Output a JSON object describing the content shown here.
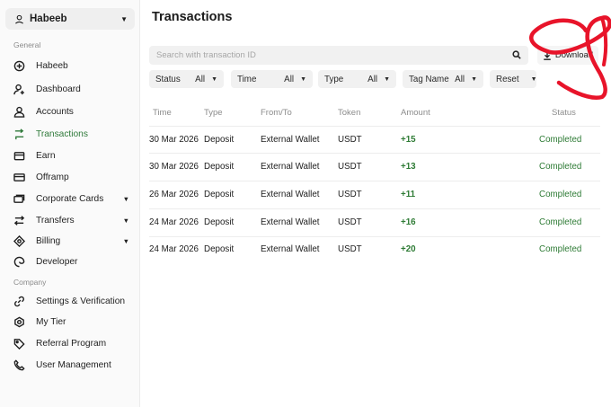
{
  "account": {
    "name": "Habeeb",
    "icon": "user-icon"
  },
  "sidebar": {
    "general_label": "General",
    "company_label": "Company",
    "items": [
      {
        "label": "Habeeb",
        "icon": "plus-circle-icon",
        "active": false
      },
      {
        "label": "Dashboard",
        "icon": "user-plus-icon",
        "active": false
      },
      {
        "label": "Accounts",
        "icon": "user-icon",
        "active": false
      },
      {
        "label": "Transactions",
        "icon": "transfer-arrows-icon",
        "active": true
      },
      {
        "label": "Earn",
        "icon": "wallet-icon",
        "active": false
      },
      {
        "label": "Offramp",
        "icon": "card-icon",
        "active": false
      },
      {
        "label": "Corporate Cards",
        "icon": "card-stack-icon",
        "active": false,
        "expandable": true
      },
      {
        "label": "Transfers",
        "icon": "transfer-icon",
        "active": false,
        "expandable": true
      },
      {
        "label": "Billing",
        "icon": "diamond-icon",
        "active": false,
        "expandable": true
      },
      {
        "label": "Developer",
        "icon": "swirl-icon",
        "active": false
      }
    ],
    "company_items": [
      {
        "label": "Settings & Verification",
        "icon": "link-icon"
      },
      {
        "label": "My Tier",
        "icon": "tier-icon"
      },
      {
        "label": "Referral Program",
        "icon": "tag-icon"
      },
      {
        "label": "User Management",
        "icon": "phone-icon"
      }
    ]
  },
  "main": {
    "title": "Transactions",
    "search_placeholder": "Search with transaction ID",
    "download_label": "Download",
    "filters": [
      {
        "label": "Status",
        "value": "All"
      },
      {
        "label": "Time",
        "value": "All"
      },
      {
        "label": "Type",
        "value": "All"
      },
      {
        "label": "Tag Name",
        "value": "All"
      },
      {
        "label": "Reset",
        "value": ""
      }
    ],
    "columns": [
      "Time",
      "Type",
      "From/To",
      "Token",
      "Amount",
      "Status"
    ],
    "rows": [
      {
        "time": "30 Mar 2026",
        "type": "Deposit",
        "from_to": "External Wallet",
        "token": "USDT",
        "amount": "+15",
        "status": "Completed"
      },
      {
        "time": "30 Mar 2026",
        "type": "Deposit",
        "from_to": "External Wallet",
        "token": "USDT",
        "amount": "+13",
        "status": "Completed"
      },
      {
        "time": "26 Mar 2026",
        "type": "Deposit",
        "from_to": "External Wallet",
        "token": "USDT",
        "amount": "+11",
        "status": "Completed"
      },
      {
        "time": "24 Mar 2026",
        "type": "Deposit",
        "from_to": "External Wallet",
        "token": "USDT",
        "amount": "+16",
        "status": "Completed"
      },
      {
        "time": "24 Mar 2026",
        "type": "Deposit",
        "from_to": "External Wallet",
        "token": "USDT",
        "amount": "+20",
        "status": "Completed"
      }
    ]
  },
  "colors": {
    "accent": "#2f7a3a",
    "annotation": "#e8142a"
  }
}
